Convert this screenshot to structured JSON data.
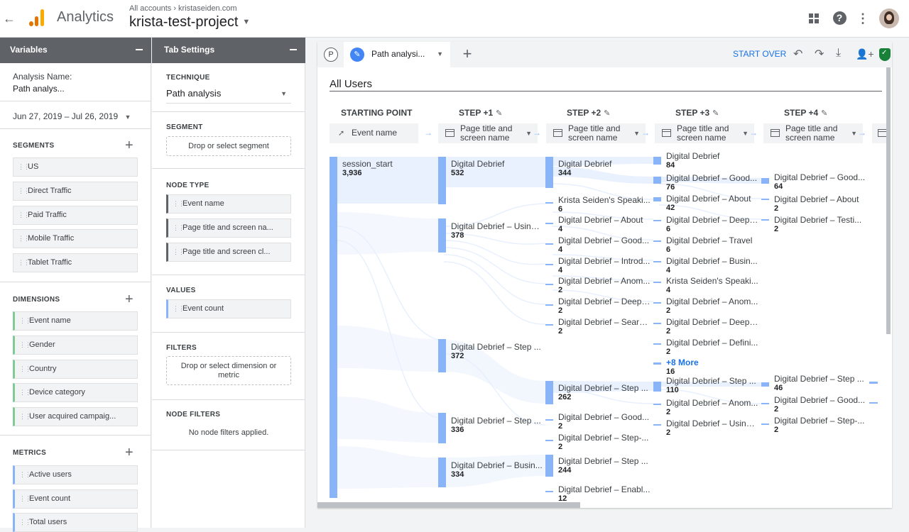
{
  "topbar": {
    "product": "Analytics",
    "breadcrumb": [
      "All accounts",
      "kristaseiden.com"
    ],
    "project": "krista-test-project"
  },
  "variables": {
    "header": "Variables",
    "analysis_name_label": "Analysis Name:",
    "analysis_name": "Path analys...",
    "date_range": "Jun 27, 2019 – Jul 26, 2019",
    "segments_title": "SEGMENTS",
    "segments": [
      "US",
      "Direct Traffic",
      "Paid Traffic",
      "Mobile Traffic",
      "Tablet Traffic"
    ],
    "dimensions_title": "DIMENSIONS",
    "dimensions": [
      "Event name",
      "Gender",
      "Country",
      "Device category",
      "User acquired campaig..."
    ],
    "metrics_title": "METRICS",
    "metrics": [
      "Active users",
      "Event count",
      "Total users"
    ]
  },
  "tab_settings": {
    "header": "Tab Settings",
    "technique_title": "TECHNIQUE",
    "technique": "Path analysis",
    "segment_title": "SEGMENT",
    "segment_drop": "Drop or select segment",
    "node_type_title": "NODE TYPE",
    "node_types": [
      "Event name",
      "Page title and screen na...",
      "Page title and screen cl..."
    ],
    "values_title": "VALUES",
    "value": "Event count",
    "filters_title": "FILTERS",
    "filters_drop": "Drop or select dimension or metric",
    "node_filters_title": "NODE FILTERS",
    "node_filters_empty": "No node filters applied."
  },
  "canvas": {
    "tab_p": "P",
    "tab_label": "Path analysi...",
    "start_over": "START OVER",
    "segment_label": "All Users",
    "steps": [
      {
        "title": "STARTING POINT",
        "selector": "Event name"
      },
      {
        "title": "STEP +1",
        "selector": "Page title and screen name"
      },
      {
        "title": "STEP +2",
        "selector": "Page title and screen name"
      },
      {
        "title": "STEP +3",
        "selector": "Page title and screen name"
      },
      {
        "title": "STEP +4",
        "selector": "Page title and screen name"
      }
    ],
    "col0": [
      {
        "label": "session_start",
        "value": "3,936"
      }
    ],
    "col1": [
      {
        "label": "Digital Debrief",
        "value": "532"
      },
      {
        "label": "Digital Debrief – Using ...",
        "value": "378"
      },
      {
        "label": "Digital Debrief – Step ...",
        "value": "372"
      },
      {
        "label": "Digital Debrief – Step ...",
        "value": "336"
      },
      {
        "label": "Digital Debrief – Busin...",
        "value": "334"
      }
    ],
    "col2": [
      {
        "label": "Digital Debrief",
        "value": "344"
      },
      {
        "label": "Krista Seiden's Speaki...",
        "value": "6"
      },
      {
        "label": "Digital Debrief – About",
        "value": "4"
      },
      {
        "label": "Digital Debrief – Good...",
        "value": "4"
      },
      {
        "label": "Digital Debrief – Introd...",
        "value": "4"
      },
      {
        "label": "Digital Debrief – Anom...",
        "value": "2"
      },
      {
        "label": "Digital Debrief – Deep-...",
        "value": "2"
      },
      {
        "label": "Digital Debrief – Searc...",
        "value": "2"
      },
      {
        "label": "Digital Debrief – Step ...",
        "value": "262"
      },
      {
        "label": "Digital Debrief – Good...",
        "value": "2"
      },
      {
        "label": "Digital Debrief – Step-...",
        "value": "2"
      },
      {
        "label": "Digital Debrief – Step ...",
        "value": "244"
      },
      {
        "label": "Digital Debrief – Enabl...",
        "value": "12"
      }
    ],
    "col3": [
      {
        "label": "Digital Debrief",
        "value": "84"
      },
      {
        "label": "Digital Debrief – Good...",
        "value": "76"
      },
      {
        "label": "Digital Debrief – About",
        "value": "42"
      },
      {
        "label": "Digital Debrief – Deep-...",
        "value": "6"
      },
      {
        "label": "Digital Debrief – Travel",
        "value": "6"
      },
      {
        "label": "Digital Debrief – Busin...",
        "value": "4"
      },
      {
        "label": "Krista Seiden's Speaki...",
        "value": "4"
      },
      {
        "label": "Digital Debrief – Anom...",
        "value": "2"
      },
      {
        "label": "Digital Debrief – Deep-...",
        "value": "2"
      },
      {
        "label": "Digital Debrief – Defini...",
        "value": "2"
      },
      {
        "label": "+8 More",
        "value": "16"
      },
      {
        "label": "Digital Debrief – Step ...",
        "value": "110"
      },
      {
        "label": "Digital Debrief – Anom...",
        "value": "2"
      },
      {
        "label": "Digital Debrief – Using ...",
        "value": "2"
      }
    ],
    "col4": [
      {
        "label": "Digital Debrief – Good...",
        "value": "64"
      },
      {
        "label": "Digital Debrief – About",
        "value": "2"
      },
      {
        "label": "Digital Debrief – Testi...",
        "value": "2"
      },
      {
        "label": "Digital Debrief – Step ...",
        "value": "46"
      },
      {
        "label": "Digital Debrief – Good...",
        "value": "2"
      },
      {
        "label": "Digital Debrief – Step-...",
        "value": "2"
      }
    ]
  }
}
